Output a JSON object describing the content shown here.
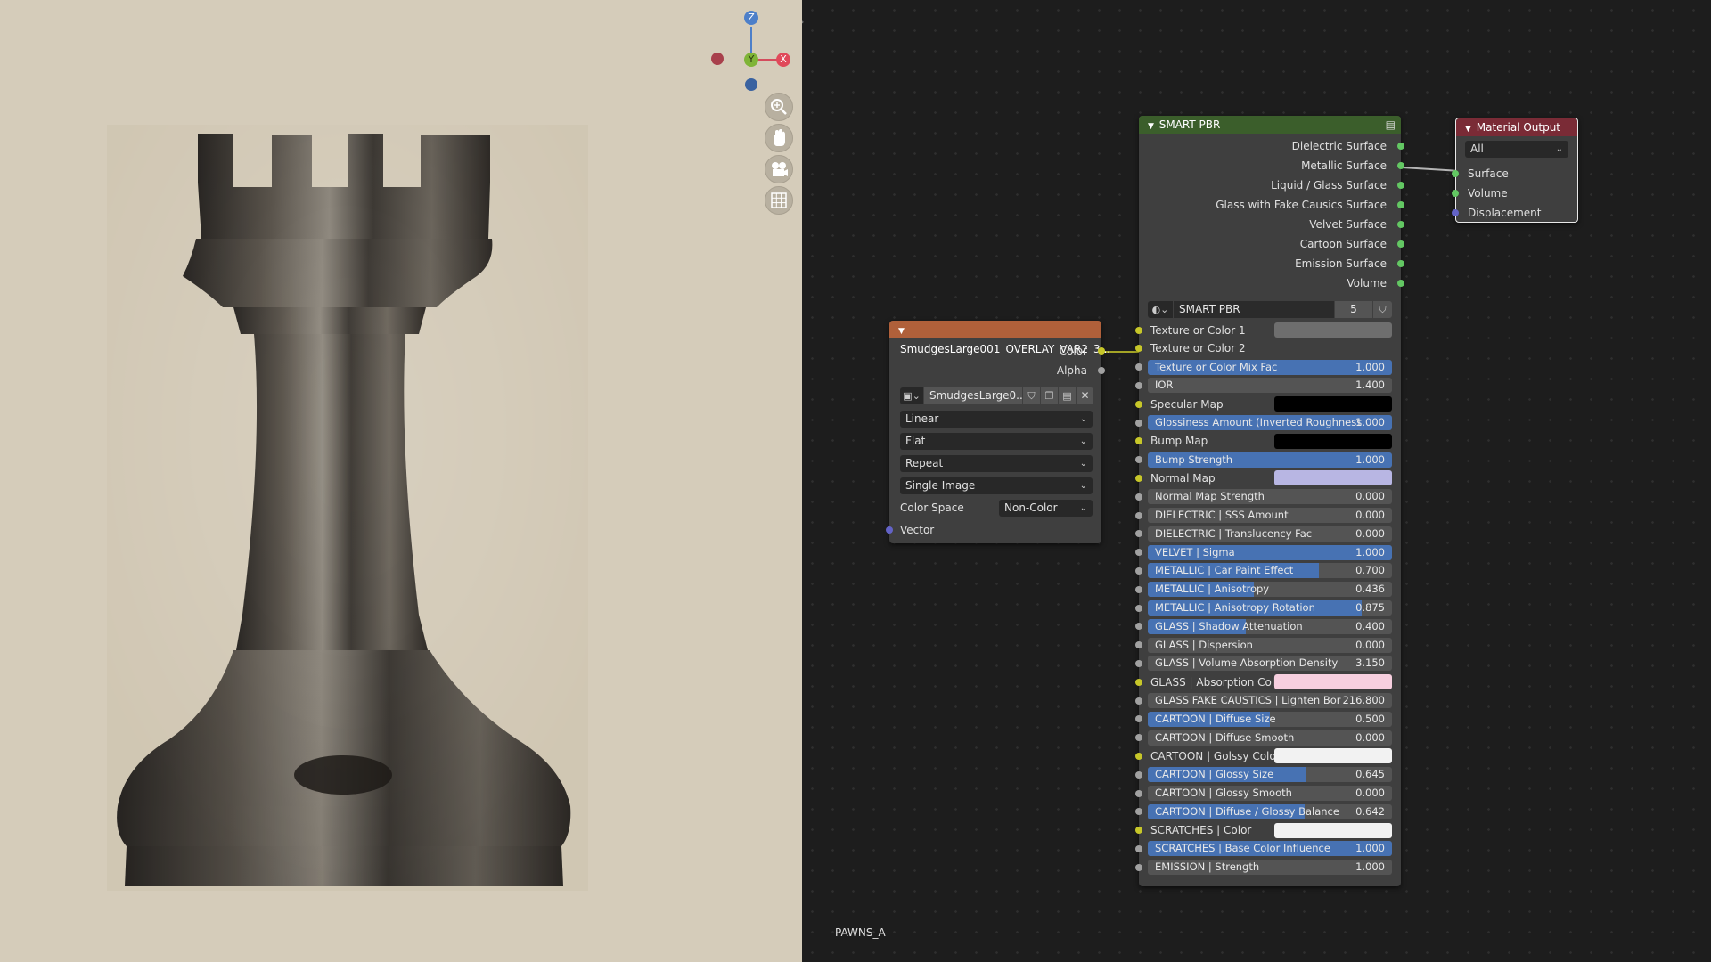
{
  "viewport": {
    "background": "#d5ccba",
    "gizmo": {
      "z": "Z",
      "y": "Y",
      "x": "X"
    },
    "tools": [
      "zoom-icon",
      "hand-pan-icon",
      "camera-icon",
      "grid-icon"
    ]
  },
  "editor": {
    "label": "PAWNS_A"
  },
  "smart_pbr": {
    "title": "SMART PBR",
    "header_color": "#3b5e2b",
    "outputs": [
      "Dielectric Surface",
      "Metallic Surface",
      "Liquid / Glass Surface",
      "Glass with Fake Causics Surface",
      "Velvet Surface",
      "Cartoon Surface",
      "Emission Surface",
      "Volume"
    ],
    "group_name": "SMART PBR",
    "group_users": "5",
    "inputs": [
      {
        "label": "Texture or Color 1",
        "kind": "swatch",
        "color": "#6e6e6e",
        "sock": "yellow"
      },
      {
        "label": "Texture or Color 2",
        "kind": "label",
        "sock": "yellow"
      },
      {
        "label": "Texture or Color Mix Fac",
        "kind": "slider",
        "value": "1.000",
        "fill": 1.0,
        "sock": "gray"
      },
      {
        "label": "IOR",
        "kind": "slider",
        "value": "1.400",
        "fill": 0,
        "sock": "gray"
      },
      {
        "label": "Specular Map",
        "kind": "swatch",
        "color": "#000000",
        "sock": "yellow"
      },
      {
        "label": "Glossiness Amount (Inverted Roughness",
        "kind": "slider",
        "value": "1.000",
        "fill": 1.0,
        "sock": "gray"
      },
      {
        "label": "Bump Map",
        "kind": "swatch",
        "color": "#000000",
        "sock": "yellow"
      },
      {
        "label": "Bump Strength",
        "kind": "slider",
        "value": "1.000",
        "fill": 1.0,
        "sock": "gray"
      },
      {
        "label": "Normal Map",
        "kind": "swatch",
        "color": "#b8b6e3",
        "sock": "yellow"
      },
      {
        "label": "Normal Map Strength",
        "kind": "slider",
        "value": "0.000",
        "fill": 0,
        "sock": "gray"
      },
      {
        "label": "DIELECTRIC | SSS Amount",
        "kind": "slider",
        "value": "0.000",
        "fill": 0,
        "sock": "gray"
      },
      {
        "label": "DIELECTRIC | Translucency Fac",
        "kind": "slider",
        "value": "0.000",
        "fill": 0,
        "sock": "gray"
      },
      {
        "label": "VELVET | Sigma",
        "kind": "slider",
        "value": "1.000",
        "fill": 1.0,
        "sock": "gray"
      },
      {
        "label": "METALLIC | Car Paint Effect",
        "kind": "slider",
        "value": "0.700",
        "fill": 0.7,
        "sock": "gray"
      },
      {
        "label": "METALLIC | Anisotropy",
        "kind": "slider",
        "value": "0.436",
        "fill": 0.436,
        "sock": "gray"
      },
      {
        "label": "METALLIC | Anisotropy Rotation",
        "kind": "slider",
        "value": "0.875",
        "fill": 0.875,
        "sock": "gray"
      },
      {
        "label": "GLASS | Shadow Attenuation",
        "kind": "slider",
        "value": "0.400",
        "fill": 0.4,
        "sock": "gray"
      },
      {
        "label": "GLASS | Dispersion",
        "kind": "slider",
        "value": "0.000",
        "fill": 0,
        "sock": "gray"
      },
      {
        "label": "GLASS | Volume Absorption Density",
        "kind": "slider",
        "value": "3.150",
        "fill": 0,
        "sock": "gray"
      },
      {
        "label": "GLASS | Absorption Col...",
        "kind": "swatch",
        "color": "#f7cfdf",
        "sock": "yellow"
      },
      {
        "label": "GLASS FAKE CAUSTICS | Lighten Bor",
        "kind": "slider",
        "value": "216.800",
        "fill": 0,
        "sock": "gray"
      },
      {
        "label": "CARTOON | Diffuse Size",
        "kind": "slider",
        "value": "0.500",
        "fill": 0.5,
        "sock": "gray"
      },
      {
        "label": "CARTOON | Diffuse Smooth",
        "kind": "slider",
        "value": "0.000",
        "fill": 0,
        "sock": "gray"
      },
      {
        "label": "CARTOON | Golssy Color",
        "kind": "swatch",
        "color": "#f2f2f2",
        "sock": "yellow"
      },
      {
        "label": "CARTOON | Glossy Size",
        "kind": "slider",
        "value": "0.645",
        "fill": 0.645,
        "sock": "gray"
      },
      {
        "label": "CARTOON | Glossy Smooth",
        "kind": "slider",
        "value": "0.000",
        "fill": 0,
        "sock": "gray"
      },
      {
        "label": "CARTOON | Diffuse / Glossy Balance",
        "kind": "slider",
        "value": "0.642",
        "fill": 0.642,
        "sock": "gray"
      },
      {
        "label": "SCRATCHES | Color",
        "kind": "swatch",
        "color": "#f2f2f2",
        "sock": "yellow"
      },
      {
        "label": "SCRATCHES | Base Color Influence",
        "kind": "slider",
        "value": "1.000",
        "fill": 1.0,
        "sock": "gray"
      },
      {
        "label": "EMISSION | Strength",
        "kind": "slider",
        "value": "1.000",
        "fill": 0,
        "sock": "gray"
      }
    ]
  },
  "material_output": {
    "title": "Material Output",
    "header_color": "#7a2b36",
    "target": "All",
    "inputs": [
      "Surface",
      "Volume",
      "Displacement"
    ]
  },
  "image_node": {
    "title": "SmudgesLarge001_OVERLAY_VAR2_3...",
    "header_color": "#b0603a",
    "outputs": [
      "Color",
      "Alpha"
    ],
    "image_name": "SmudgesLarge0...",
    "interpolation": "Linear",
    "projection": "Flat",
    "extension": "Repeat",
    "source": "Single Image",
    "color_space_label": "Color Space",
    "color_space": "Non-Color",
    "vector_label": "Vector"
  }
}
